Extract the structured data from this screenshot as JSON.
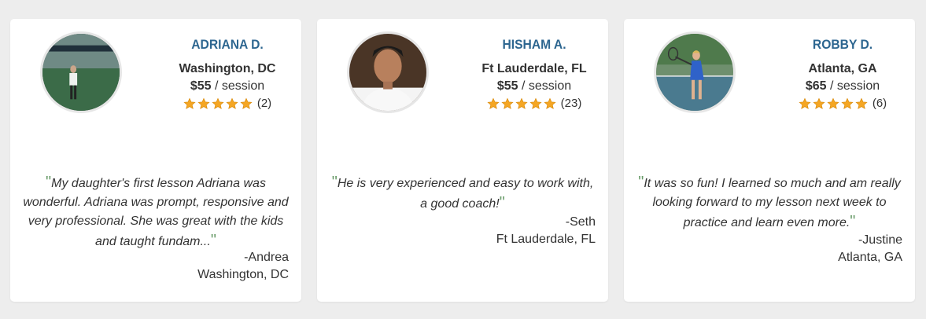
{
  "cards": [
    {
      "name": "ADRIANA D.",
      "location": "Washington, DC",
      "price": "$55",
      "per": " / session",
      "rating_stars": 5,
      "review_count": "(2)",
      "quote": "My daughter's first lesson Adriana was wonderful. Adriana was prompt, responsive and very professional. She was great with the kids and taught fundam...",
      "author": "-Andrea",
      "author_location": "Washington, DC"
    },
    {
      "name": "HISHAM A.",
      "location": "Ft Lauderdale, FL",
      "price": "$55",
      "per": " / session",
      "rating_stars": 5,
      "review_count": "(23)",
      "quote": "He is very experienced and easy to work with, a good coach!",
      "author": "-Seth",
      "author_location": "Ft Lauderdale, FL"
    },
    {
      "name": "ROBBY D.",
      "location": "Atlanta, GA",
      "price": "$65",
      "per": " / session",
      "rating_stars": 5,
      "review_count": "(6)",
      "quote": "It was so fun! I learned so much and am really looking forward to my lesson next week to practice and learn even more.",
      "author": "-Justine",
      "author_location": "Atlanta, GA"
    }
  ],
  "colors": {
    "name": "#2d6690",
    "star": "#f5a623",
    "quote_mark": "#6a9c6a",
    "background": "#ededed"
  },
  "icons": {
    "star": "star-icon",
    "open_quote": "open-quote-icon",
    "close_quote": "close-quote-icon"
  }
}
